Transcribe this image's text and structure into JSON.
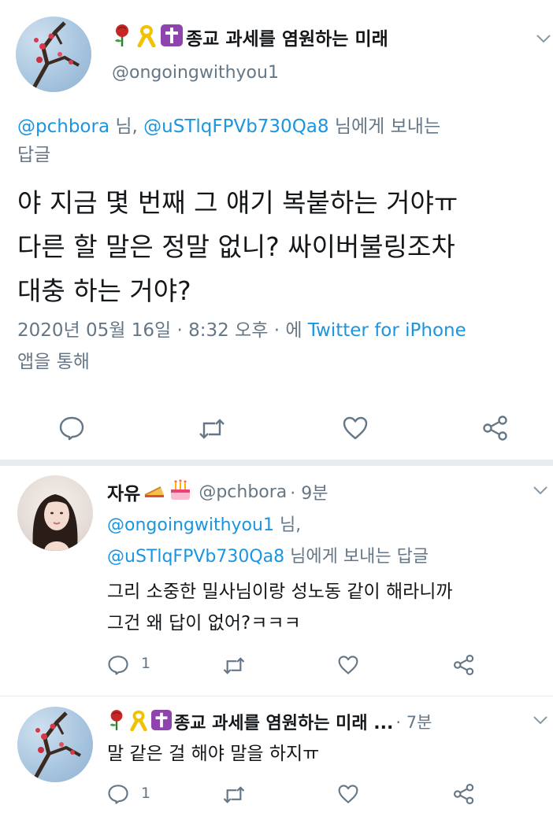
{
  "main_tweet": {
    "display_name": "종교 과세를 염원하는 미래",
    "handle": "@ongoingwithyou1",
    "reply_to": {
      "mention1": "@pchbora",
      "sep1": " 님, ",
      "mention2": "@uSTlqFPVb730Qa8",
      "suffix": " 님에게 보내는",
      "line2": "답글"
    },
    "text_lines": [
      "야 지금 몇 번째 그 얘기 복붙하는 거야ㅠ",
      "다른 할 말은 정말 없니? 싸이버불링조차",
      "대충 하는 거야?"
    ],
    "timestamp": "2020년 05월 16일 · 8:32 오후 · 에 ",
    "source": "Twitter for iPhone",
    "source_suffix": "앱을 통해",
    "actions": [
      "reply-icon",
      "retweet-icon",
      "like-icon",
      "share-icon"
    ]
  },
  "reply1": {
    "display_name": "자유",
    "handle": "@pchbora",
    "time": " · 9분",
    "reply_to_line1_mention": "@ongoingwithyou1",
    "reply_to_line1_suffix": " 님,",
    "reply_to_line2_mention": "@uSTlqFPVb730Qa8",
    "reply_to_line2_suffix": " 님에게 보내는 답글",
    "text_lines": [
      "그리 소중한 밀사님이랑 성노동 같이 해라니까",
      "그건 왜 답이 없어?ㅋㅋㅋ"
    ],
    "reply_count": "1"
  },
  "reply2": {
    "display_name": "종교 과세를 염원하는 미래 ...",
    "time": " · 7분",
    "text": "말 같은 걸 해야 말을 하지ㅠ",
    "reply_count": "1"
  },
  "colors": {
    "link": "#1b95e0",
    "muted": "#657786",
    "divider": "#e6ecf0"
  }
}
